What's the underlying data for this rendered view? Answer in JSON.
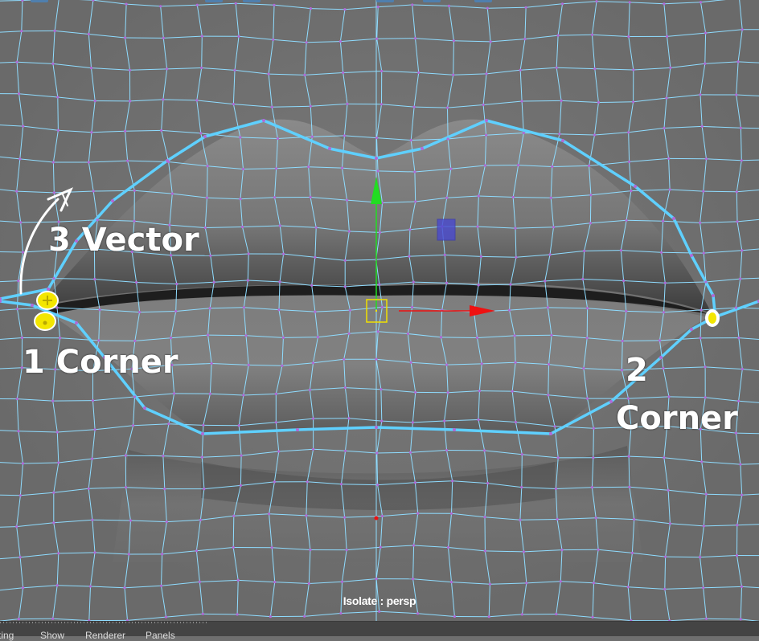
{
  "viewport": {
    "annotations": {
      "corner_1": "1 Corner",
      "corner_2_number": "2",
      "corner_2_word": "Corner",
      "vector": "3 Vector"
    },
    "isolate_label": "Isolate : persp"
  },
  "menubar": {
    "items": [
      "ting",
      "Show",
      "Renderer",
      "Panels"
    ]
  },
  "colors": {
    "background": "#6f6f6f",
    "wire": "#8fdcff",
    "edge_loop": "#5fd0ff",
    "vertex": "#b06ad8",
    "manip_y": "#22dd22",
    "manip_x": "#ee1111",
    "manip_center": "#f0e000",
    "manip_plane": "#4a4ad0",
    "selected_vertex": "#f3e600"
  },
  "icons": [
    "move-manipulator-icon",
    "arrow-annotation-icon"
  ]
}
